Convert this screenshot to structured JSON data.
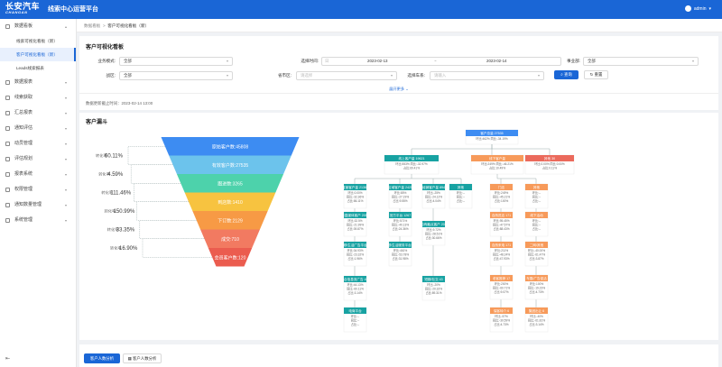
{
  "header": {
    "logo_cn": "长安汽车",
    "logo_en": "CHANGAN",
    "title": "线索中心运营平台",
    "user": "admin"
  },
  "sidebar": {
    "items": [
      {
        "label": "数据看板",
        "expanded": true,
        "children": [
          "线索可视化看板（新）",
          "客户可视化看板（新）",
          "Leads线索报表"
        ]
      },
      {
        "label": "数据报表"
      },
      {
        "label": "线索获取"
      },
      {
        "label": "汇总报表"
      },
      {
        "label": "通知评估"
      },
      {
        "label": "动员管理"
      },
      {
        "label": "评估规划"
      },
      {
        "label": "报表系统"
      },
      {
        "label": "权限管理"
      },
      {
        "label": "通知数量管理"
      },
      {
        "label": "系统管理"
      }
    ],
    "active_child": "客户可视化看板（新）"
  },
  "breadcrumb": {
    "root": "数据看板",
    "current": "客户可视化看板（新）"
  },
  "filters": {
    "title": "客户可视化看板",
    "row1": [
      {
        "label": "业务模式:",
        "value": "全部"
      },
      {
        "label": "选择时间:",
        "start": "2023-02-13",
        "end": "2023-02-14",
        "prefix": "日"
      },
      {
        "label": "事业部:",
        "value": "全部"
      }
    ],
    "row2": [
      {
        "label": "战区:",
        "value": "全部"
      },
      {
        "label": "省市区:",
        "value": "请选择"
      },
      {
        "label": "选择车系:",
        "value": "请输入"
      }
    ],
    "query": "查询",
    "reset": "重置",
    "expand": "展开更多",
    "asof": "数据更新截止时间：2023-02-14 13:00"
  },
  "funnel_section": {
    "title": "客户漏斗",
    "stages": [
      {
        "label": "原始客户数:45808",
        "color": "#3d8cf2"
      },
      {
        "label": "有效客户数:27535",
        "color": "#6cc3ec"
      },
      {
        "label": "跟进数:3265",
        "color": "#4dd2ab"
      },
      {
        "label": "到店数:1410",
        "color": "#f7c340"
      },
      {
        "label": "下订数:2129",
        "color": "#f79a45"
      },
      {
        "label": "成交:710",
        "color": "#f27a61"
      },
      {
        "label": "会员客户数:120",
        "color": "#eb5c4f"
      }
    ],
    "rates": [
      {
        "label": "转化率",
        "value": "60.11%"
      },
      {
        "label": "转化率",
        "value": "4.59%"
      },
      {
        "label": "转化率",
        "value": "111.46%"
      },
      {
        "label": "转化率",
        "value": "150.99%"
      },
      {
        "label": "转化率",
        "value": "33.35%"
      },
      {
        "label": "转化率",
        "value": "16.90%"
      }
    ]
  },
  "org": {
    "root": {
      "title": "客户总量 27535",
      "lines": [
        "环比:462%  同比:-34.19%"
      ]
    },
    "level1": [
      {
        "title": "线上客户量 19621",
        "lines": [
          "环比:553%  同比:-32.97%",
          "占比:69.41%"
        ],
        "color": "#17a2a2"
      },
      {
        "title": "线下客户量",
        "lines": [
          "环比:249%  同比:-46.21%",
          "占比:10.49%"
        ],
        "color": "#f79a5a"
      },
      {
        "title": "其他 30",
        "lines": [
          "环比:0.00%  同比:0.00%",
          "占比:0.11%"
        ],
        "color": "#eb6a5c"
      }
    ],
    "teal": [
      {
        "title": "直营客户量 21363",
        "lines": [
          "环比:0.00%",
          "同比:-32.36%",
          "占比:86.11%"
        ]
      },
      {
        "title": "区域客户量 2425",
        "lines": [
          "环比:85%",
          "同比:-27.19%",
          "占比:9.55%"
        ]
      },
      {
        "title": "经销客户量 894",
        "lines": [
          "环比:-25%",
          "同比:-24.12%",
          "占比:4.04%"
        ]
      },
      {
        "title": "其他",
        "lines": [
          "环比:--",
          "同比:--",
          "占比:--"
        ]
      },
      {
        "title": "垂直媒体客户 2057",
        "lines": [
          "环比:32.5%",
          "同比:-21.99%",
          "占比:39.87%"
        ]
      },
      {
        "title": "官方平台 1267",
        "lines": [
          "环比:571%",
          "同比:-40.13%",
          "占比:24.36%"
        ]
      },
      {
        "title": "自有触点客户 205",
        "lines": [
          "环比:9.72%",
          "同比:-28.51%",
          "占比:30.66%"
        ]
      },
      {
        "title": "短视频/生活广告平台 421",
        "lines": [
          "环比:34.93%",
          "同比:-23.32%",
          "占比:1.96%"
        ]
      },
      {
        "title": "短视频/生活服务平台 1258",
        "lines": [
          "环比:461%",
          "同比:-53.78%",
          "占比:31.98%"
        ]
      },
      {
        "title": "短期/社交 43",
        "lines": [
          "环比:-20%",
          "同比:-20.32%",
          "占比:89.31%"
        ]
      },
      {
        "title": "综合信息流广告 494",
        "lines": [
          "环比:44.13%",
          "同比:-60.11%",
          "占比:3.14%"
        ]
      },
      {
        "title": "电商平台",
        "lines": [
          "环比:--",
          "同比:--",
          "占比:--"
        ]
      }
    ],
    "orange": [
      {
        "title": "门店",
        "lines": [
          "环比:249%",
          "同比:-45.21%",
          "占比:100%"
        ]
      },
      {
        "title": "其他",
        "lines": [
          "环比:--",
          "同比:--",
          "占比:--"
        ]
      },
      {
        "title": "自然进店 171",
        "lines": [
          "环比:95.45%",
          "同比:-47.57%",
          "占比:88.43%"
        ]
      },
      {
        "title": "线下活动",
        "lines": [
          "环比:--",
          "同比:--",
          "占比:--"
        ]
      },
      {
        "title": "自然来电 171",
        "lines": [
          "环比:211%",
          "同比:-48.24%",
          "占比:47.93%"
        ]
      },
      {
        "title": "二网/其他",
        "lines": [
          "环比:-40.00%",
          "同比:-61.47%",
          "占比:3.87%"
        ]
      },
      {
        "title": "老客推荐 17",
        "lines": [
          "环比:200%",
          "同比:-60.71%",
          "占比:9.07%"
        ]
      },
      {
        "title": "车展/广告促活",
        "lines": [
          "环比:100%",
          "同比:-19.23%",
          "占比:4.73%"
        ]
      },
      {
        "title": "保客转介 6",
        "lines": [
          "环比:-57%",
          "同比:-30.59%",
          "占比:4.73%"
        ]
      },
      {
        "title": "集团出让 6",
        "lines": [
          "环比:-40%",
          "同比:-61.81%",
          "占比:3.14%"
        ]
      },
      {
        "title": "展厅外拓",
        "lines": [
          "环比:--",
          "同比:--",
          "占比:--"
        ]
      }
    ]
  },
  "bottom_tabs": [
    "客户人数分析",
    "客户人数分析"
  ]
}
